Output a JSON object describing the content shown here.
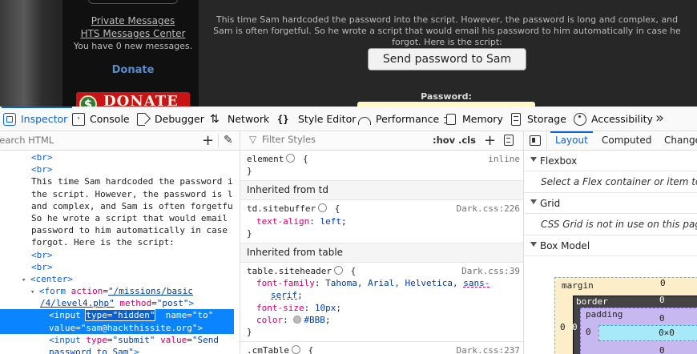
{
  "page": {
    "sidebar": {
      "links": [
        "Private Messages",
        "HTS Messages Center"
      ],
      "messages_text": "You have 0 new messages.",
      "donate_link": "Donate",
      "donate_banner": "DONATE"
    },
    "intro_text": "This time Sam hardcoded the password into the script. However, the password is long and complex, and Sam is often forgetful. So he wrote a script that would email his password to him automatically in case he forgot. Here is the script:",
    "send_button": "Send password to Sam",
    "password_label": "Password:"
  },
  "devtools": {
    "tabs": [
      {
        "label": "Inspector",
        "icon": "inspector-icon",
        "active": true
      },
      {
        "label": "Console",
        "icon": "console-icon"
      },
      {
        "label": "Debugger",
        "icon": "debugger-icon"
      },
      {
        "label": "Network",
        "icon": "network-icon"
      },
      {
        "label": "Style Editor",
        "icon": "style-editor-icon"
      },
      {
        "label": "Performance",
        "icon": "performance-icon"
      },
      {
        "label": "Memory",
        "icon": "memory-icon"
      },
      {
        "label": "Storage",
        "icon": "storage-icon"
      },
      {
        "label": "Accessibility",
        "icon": "accessibility-icon"
      }
    ],
    "more": "»",
    "markup": {
      "search_placeholder": "Search HTML",
      "lines": {
        "br1": "<br>",
        "br2": "<br>",
        "text1": "This time Sam hardcoded the password i",
        "text2": "the script. However, the password is l",
        "text3": "and complex, and Sam is often forgetfu",
        "text4": "So he wrote a script that would email ",
        "text5": "password to him automatically in case ",
        "text6": "forgot. Here is the script:",
        "br3": "<br>",
        "br4": "<br>",
        "center_tag": "center",
        "form_tag": "form",
        "form_action_attr": "action",
        "form_action_val1": "\"/missions/basic",
        "form_action_val2": "/4/level4.php\"",
        "form_method_attr": "method",
        "form_method_val": "\"post\"",
        "input1_tag": "input",
        "input1_type": "type=\"hidden\"",
        "input1_name_attr": "name",
        "input1_name_val": "\"to\"",
        "input1_value_attr": "value",
        "input1_value_val": "\"sam@hackthissite.org\"",
        "input2_tag": "input",
        "input2_type_attr": "type",
        "input2_type_val": "\"submit\"",
        "input2_value_attr": "value",
        "input2_value_val1": "\"Send",
        "input2_value_val2": "password to Sam\""
      }
    },
    "rules": {
      "filter_placeholder": "Filter Styles",
      "hov": ":hov",
      "cls": ".cls",
      "element_selector": "element",
      "element_source": "inline",
      "inherited_td": "Inherited from td",
      "td_selector": "td.sitebuffer",
      "td_source": "Dark.css:226",
      "td_prop": "text-align",
      "td_value": "left",
      "inherited_table": "Inherited from table",
      "table_selector": "table.siteheader",
      "table_source": "Dark.css:39",
      "font_family_prop": "font-family",
      "font_family_value": "Tahoma, Arial, Helvetica, ",
      "font_family_generic1": "sans-",
      "font_family_generic2": "serif",
      "font_size_prop": "font-size",
      "font_size_value": "10px",
      "color_prop": "color",
      "color_value": "#BBB",
      "cm_selector": ".cmTable",
      "cm_source": "Dark.css:237"
    },
    "side": {
      "tabs": [
        "Layout",
        "Computed",
        "Changes"
      ],
      "flexbox_heading": "Flexbox",
      "flexbox_text": "Select a Flex container or item to continue.",
      "grid_heading": "Grid",
      "grid_text": "CSS Grid is not in use on this page",
      "boxmodel_heading": "Box Model",
      "margin_label": "margin",
      "border_label": "border",
      "padding_label": "padding",
      "margin_top": "0",
      "border_top": "0",
      "padding_top": "0",
      "margin_left": "0",
      "border_left": "0",
      "padding_left": "0",
      "content_size": "0×0",
      "padding_bottom": "0"
    }
  },
  "colors": {
    "accent": "#0a62d8",
    "selected_row": "#0a84ff",
    "page_bg": "#272727",
    "donate_red": "#c81414"
  }
}
